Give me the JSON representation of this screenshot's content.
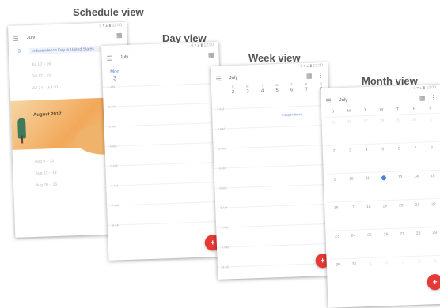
{
  "captions": {
    "schedule": "Schedule view",
    "day": "Day view",
    "week": "Week view",
    "month": "Month view"
  },
  "status_bar": "0 ▾ ▴ ▮ 12:00",
  "toolbar": {
    "month": "July",
    "menu_icon": "hamburger-menu-icon",
    "calendar_icon": "calendar-icon",
    "more_icon": "more-vertical-icon"
  },
  "schedule": {
    "first_day": "3",
    "first_event": "Independence Day in United States",
    "rows_before": [
      "Jul 10 – 16",
      "Jul 17 – 23",
      "Jul 24 – Jul 30"
    ],
    "banner_title": "August 2017",
    "rows_after": [
      "Aug 6 – 12",
      "Aug 13 – 19",
      "Aug 20 – 26"
    ]
  },
  "day": {
    "day_label": "Mon",
    "day_num": "3",
    "hours": [
      "1 AM",
      "2 AM",
      "3 AM",
      "4 AM",
      "5 AM",
      "6 AM",
      "7 AM",
      "8 AM"
    ]
  },
  "week": {
    "days": [
      {
        "wd": "S",
        "d": "2"
      },
      {
        "wd": "M",
        "d": "3"
      },
      {
        "wd": "T",
        "d": "4"
      },
      {
        "wd": "W",
        "d": "5"
      },
      {
        "wd": "T",
        "d": "6"
      },
      {
        "wd": "F",
        "d": "7"
      },
      {
        "wd": "S",
        "d": "8"
      }
    ],
    "event": "Independence",
    "hours": [
      "1 AM",
      "2 AM",
      "3 AM",
      "4 AM",
      "5 AM",
      "6 AM",
      "7 AM",
      "8 AM",
      "9 AM",
      "10 AM"
    ]
  },
  "month": {
    "dow": [
      "S",
      "M",
      "T",
      "W",
      "T",
      "F",
      "S"
    ],
    "weeks": [
      [
        "25",
        "26",
        "27",
        "28",
        "29",
        "30",
        "1"
      ],
      [
        "2",
        "3",
        "4",
        "5",
        "6",
        "7",
        "8"
      ],
      [
        "9",
        "10",
        "11",
        "12",
        "13",
        "14",
        "15"
      ],
      [
        "16",
        "17",
        "18",
        "19",
        "20",
        "21",
        "22"
      ],
      [
        "23",
        "24",
        "25",
        "26",
        "27",
        "28",
        "29"
      ],
      [
        "30",
        "31",
        "1",
        "2",
        "3",
        "4",
        "5"
      ]
    ],
    "selected": "12"
  },
  "fab_label": "+",
  "colors": {
    "accent": "#4a84d6",
    "fab": "#e53935",
    "banner": "#f2a85a"
  }
}
